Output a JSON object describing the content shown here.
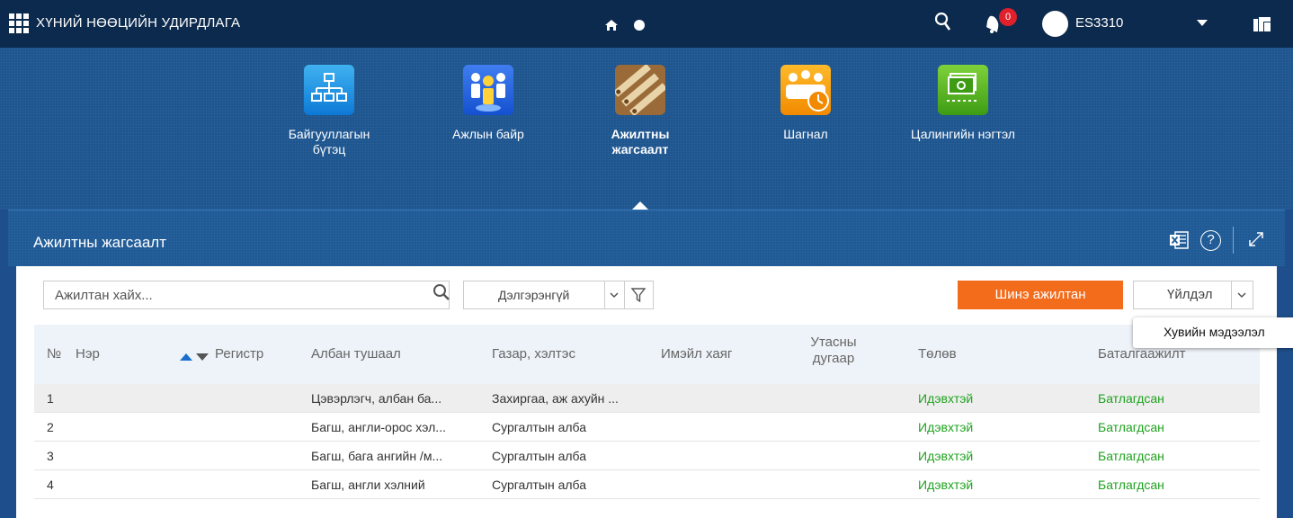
{
  "header": {
    "app_title": "ХҮНИЙ НӨӨЦИЙН УДИРДЛАГА",
    "notification_count": "0",
    "user_name": "ES3310"
  },
  "modules": [
    {
      "label": "Байгууллагын бүтэц",
      "icon": "org-chart-icon",
      "active": false
    },
    {
      "label": "Ажлын байр",
      "icon": "workplace-icon",
      "active": false
    },
    {
      "label": "Ажилтны жагсаалт",
      "icon": "employee-list-icon",
      "active": true
    },
    {
      "label": "Шагнал",
      "icon": "award-icon",
      "active": false
    },
    {
      "label": "Цалингийн нэгтэл",
      "icon": "salary-icon",
      "active": false
    }
  ],
  "panel": {
    "title": "Ажилтны жагсаалт",
    "help_label": "?"
  },
  "toolbar": {
    "search_placeholder": "Ажилтан хайх...",
    "advanced_label": "Дэлгэрэнгүй",
    "new_employee_label": "Шинэ ажилтан",
    "action_label": "Үйлдэл",
    "tooltip": "Хувийн мэдээлэл"
  },
  "table": {
    "columns": {
      "no": "№",
      "name": "Нэр",
      "register": "Регистр",
      "position": "Албан тушаал",
      "department": "Газар, хэлтэс",
      "email": "Имэйл хаяг",
      "phone_line1": "Утасны",
      "phone_line2": "дугаар",
      "status": "Төлөв",
      "confirmation": "Баталгаажилт"
    },
    "rows": [
      {
        "no": "1",
        "position": "Цэвэрлэгч, албан ба...",
        "department": "Захиргаа, аж ахуйн ...",
        "status": "Идэвхтэй",
        "confirmation": "Батлагдсан"
      },
      {
        "no": "2",
        "position": "Багш, англи-орос хэл...",
        "department": "Сургалтын алба",
        "status": "Идэвхтэй",
        "confirmation": "Батлагдсан"
      },
      {
        "no": "3",
        "position": "Багш, бага ангийн /м...",
        "department": "Сургалтын алба",
        "status": "Идэвхтэй",
        "confirmation": "Батлагдсан"
      },
      {
        "no": "4",
        "position": "Багш, англи хэлний",
        "department": "Сургалтын алба",
        "status": "Идэвхтэй",
        "confirmation": "Батлагдсан"
      }
    ]
  },
  "colors": {
    "topbar": "#0c2a4d",
    "primary": "#1d558f",
    "accent_orange": "#f26c1c",
    "status_green": "#1fa21f",
    "badge_red": "#e0202b"
  }
}
